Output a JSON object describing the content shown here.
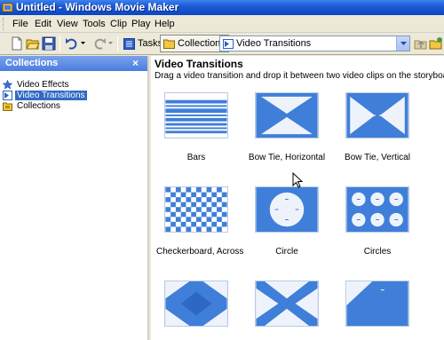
{
  "window": {
    "title": "Untitled - Windows Movie Maker"
  },
  "menu": [
    "File",
    "Edit",
    "View",
    "Tools",
    "Clip",
    "Play",
    "Help"
  ],
  "toolbar": {
    "tasks_label": "Tasks",
    "collections_label": "Collections",
    "combo_value": "Video Transitions"
  },
  "left_pane": {
    "header": "Collections",
    "close": "×",
    "items": [
      {
        "label": "Video Effects",
        "icon": "star-icon"
      },
      {
        "label": "Video Transitions",
        "icon": "transition-icon"
      },
      {
        "label": "Collections",
        "icon": "collections-folder-icon"
      }
    ]
  },
  "content": {
    "title": "Video Transitions",
    "description": "Drag a video transition and drop it between two video clips on the storyboard below.",
    "tiles": [
      {
        "label": "Bars",
        "type": "bars"
      },
      {
        "label": "Bow Tie, Horizontal",
        "type": "bowtie-h"
      },
      {
        "label": "Bow Tie, Vertical",
        "type": "bowtie-v"
      },
      {
        "label": "Checkerboard, Across",
        "type": "checker"
      },
      {
        "label": "Circle",
        "type": "circle"
      },
      {
        "label": "Circles",
        "type": "circles"
      },
      {
        "label": "",
        "type": "diamond"
      },
      {
        "label": "",
        "type": "x"
      },
      {
        "label": "",
        "type": "corner"
      }
    ]
  },
  "colors": {
    "accent": "#316ac5",
    "transition_blue": "#3f7fd9"
  }
}
